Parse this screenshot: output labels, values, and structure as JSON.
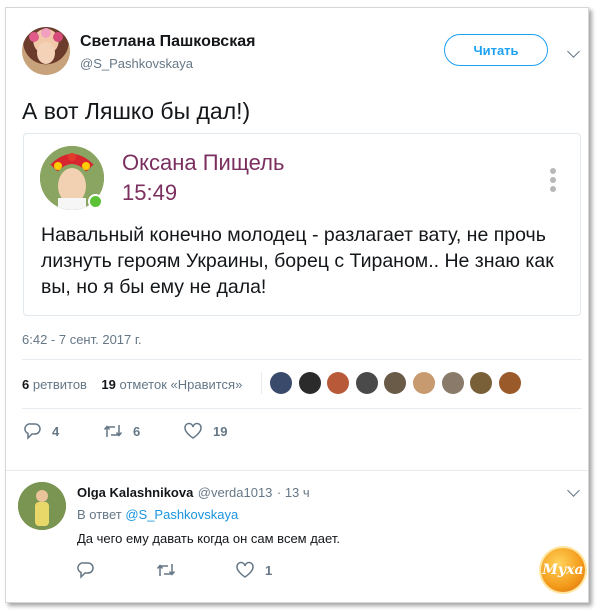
{
  "tweet": {
    "author_name": "Светлана Пашковская",
    "author_handle": "@S_Pashkovskaya",
    "follow_label": "Читать",
    "text": "А вот Ляшко бы дал!)",
    "timestamp": "6:42 - 7 сент. 2017 г.",
    "retweets_count": "6",
    "retweets_label": "ретвитов",
    "likes_count": "19",
    "likes_label": "отметок «Нравится»",
    "actions": {
      "reply_count": "4",
      "retweet_count": "6",
      "like_count": "19"
    }
  },
  "quoted_card": {
    "name": "Оксана Пищель",
    "time": "15:49",
    "text": "Навальный конечно молодец - разлагает вату, не прочь лизнуть героям Украины, борец с Тираном.. Не знаю как вы, но я бы ему не дала!",
    "name_color": "#7b2f5f"
  },
  "reply": {
    "author_name": "Olga Kalashnikova",
    "author_handle": "@verda1013",
    "time": "· 13 ч",
    "in_reply_prefix": "В ответ",
    "in_reply_handle": "@S_Pashkovskaya",
    "text": "Да чего ему давать когда он сам всем дает.",
    "actions": {
      "like_count": "1"
    }
  },
  "watermark": {
    "text": "Муха"
  },
  "colors": {
    "accent": "#1da1f2",
    "link": "#1b95e0",
    "muted": "#657786",
    "text": "#14171a"
  }
}
